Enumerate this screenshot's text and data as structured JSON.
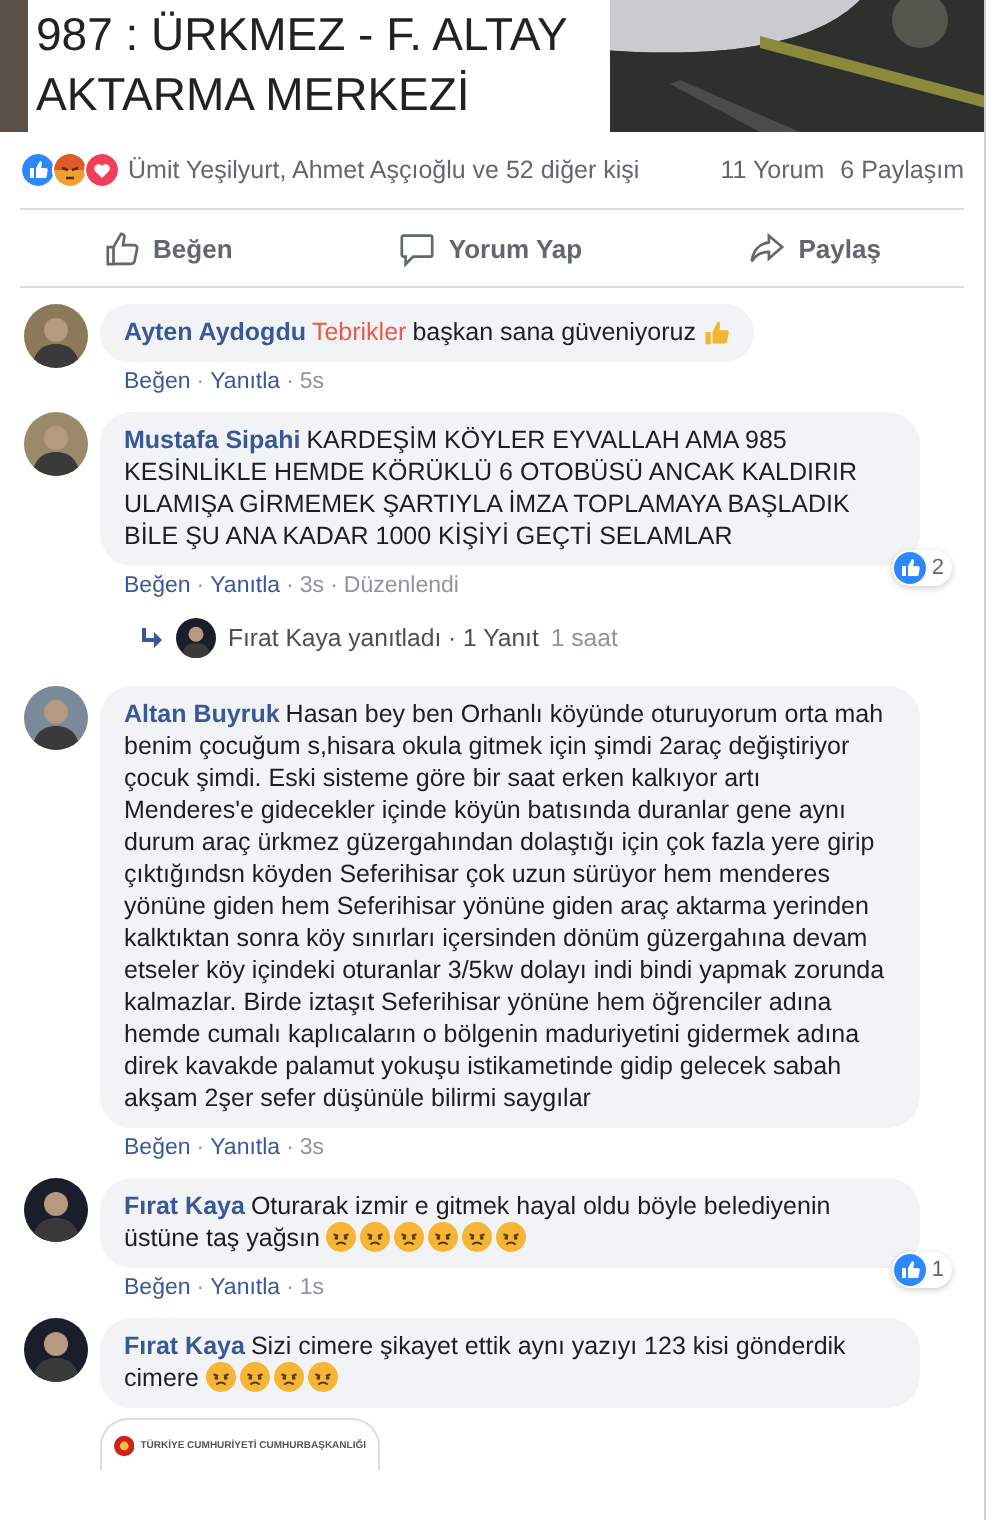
{
  "post": {
    "title_lines": [
      "987 : ÜRKMEZ - F. ALTAY",
      "AKTARMA MERKEZİ"
    ],
    "reactions": {
      "icons": [
        {
          "kind": "like"
        },
        {
          "kind": "angry"
        },
        {
          "kind": "love"
        }
      ],
      "names": "Ümit Yeşilyurt, Ahmet Aşçıoğlu ve 52 diğer kişi",
      "comments": "11 Yorum",
      "shares": "6 Paylaşım"
    },
    "actions": [
      {
        "kind": "like",
        "label": "Beğen"
      },
      {
        "kind": "comment",
        "label": "Yorum Yap"
      },
      {
        "kind": "share",
        "label": "Paylaş"
      }
    ]
  },
  "comments": [
    {
      "author": "Ayten Aydogdu",
      "mention": "Tebrikler",
      "text": "başkan sana güveniyoruz",
      "emojis": [
        {
          "kind": "thumb"
        }
      ],
      "meta": [
        {
          "kind": "link",
          "text": "Beğen"
        },
        {
          "kind": "sep",
          "text": "·"
        },
        {
          "kind": "link",
          "text": "Yanıtla"
        },
        {
          "kind": "sep",
          "text": "·"
        },
        {
          "kind": "time",
          "text": "5s"
        }
      ]
    },
    {
      "author": "Mustafa Sipahi",
      "text": "KARDEŞİM KÖYLER EYVALLAH AMA 985 KESİNLİKLE HEMDE KÖRÜKLÜ 6 OTOBÜSÜ ANCAK KALDIRIR ULAMIŞA GİRMEMEK ŞARTIYLA İMZA TOPLAMAYA BAŞLADIK BİLE ŞU ANA KADAR 1000 KİŞİYİ GEÇTİ SELAMLAR",
      "meta": [
        {
          "kind": "link",
          "text": "Beğen"
        },
        {
          "kind": "sep",
          "text": "·"
        },
        {
          "kind": "link",
          "text": "Yanıtla"
        },
        {
          "kind": "sep",
          "text": "·"
        },
        {
          "kind": "time",
          "text": "3s"
        },
        {
          "kind": "sep",
          "text": "·"
        },
        {
          "kind": "time",
          "text": "Düzenlendi"
        }
      ],
      "reaction_count": "2",
      "replies": {
        "text": "Fırat Kaya yanıtladı · 1 Yanıt",
        "time": "1 saat"
      }
    },
    {
      "author": "Altan Buyruk",
      "text": "Hasan bey ben Orhanlı köyünde oturuyorum orta mah benim çocuğum s,hisara okula gitmek için şimdi 2araç değiştiriyor çocuk şimdi. Eski sisteme göre bir saat erken kalkıyor artı Menderes'e gidecekler içinde köyün batısında duranlar gene aynı durum araç ürkmez güzergahından dolaştığı için çok fazla yere girip çıktığındsn köyden Seferihisar çok uzun sürüyor hem menderes yönüne giden hem Seferihisar yönüne giden araç aktarma yerinden kalktıktan sonra köy sınırları içersinden dönüm güzergahına devam etseler köy içindeki oturanlar 3/5kw dolayı indi bindi yapmak zorunda kalmazlar. Birde iztaşıt Seferihisar yönüne hem öğrenciler adına hemde cumalı kaplıcaların o bölgenin maduriyetini gidermek adına direk kavakde palamut yokuşu istikametinde gidip gelecek sabah akşam 2şer sefer düşünüle bilirmi saygılar",
      "meta": [
        {
          "kind": "link",
          "text": "Beğen"
        },
        {
          "kind": "sep",
          "text": "·"
        },
        {
          "kind": "link",
          "text": "Yanıtla"
        },
        {
          "kind": "sep",
          "text": "·"
        },
        {
          "kind": "time",
          "text": "3s"
        }
      ]
    },
    {
      "author": "Fırat Kaya",
      "text": "Oturarak izmir e gitmek hayal oldu böyle belediyenin üstüne taş yağsın",
      "emojis": [
        {
          "kind": "angry"
        },
        {
          "kind": "angry"
        },
        {
          "kind": "angry"
        },
        {
          "kind": "angry"
        },
        {
          "kind": "angry"
        },
        {
          "kind": "angry"
        }
      ],
      "meta": [
        {
          "kind": "link",
          "text": "Beğen"
        },
        {
          "kind": "sep",
          "text": "·"
        },
        {
          "kind": "link",
          "text": "Yanıtla"
        },
        {
          "kind": "sep",
          "text": "·"
        },
        {
          "kind": "time",
          "text": "1s"
        }
      ],
      "reaction_count": "1"
    },
    {
      "author": "Fırat Kaya",
      "text": "Sizi cimere şikayet ettik aynı yazıyı 123 kisi gönderdik cimere",
      "emojis": [
        {
          "kind": "angry"
        },
        {
          "kind": "angry"
        },
        {
          "kind": "angry"
        },
        {
          "kind": "angry"
        }
      ],
      "attachment": {
        "caption": "TÜRKİYE CUMHURİYETİ CUMHURBAŞKANLIĞI"
      }
    }
  ]
}
